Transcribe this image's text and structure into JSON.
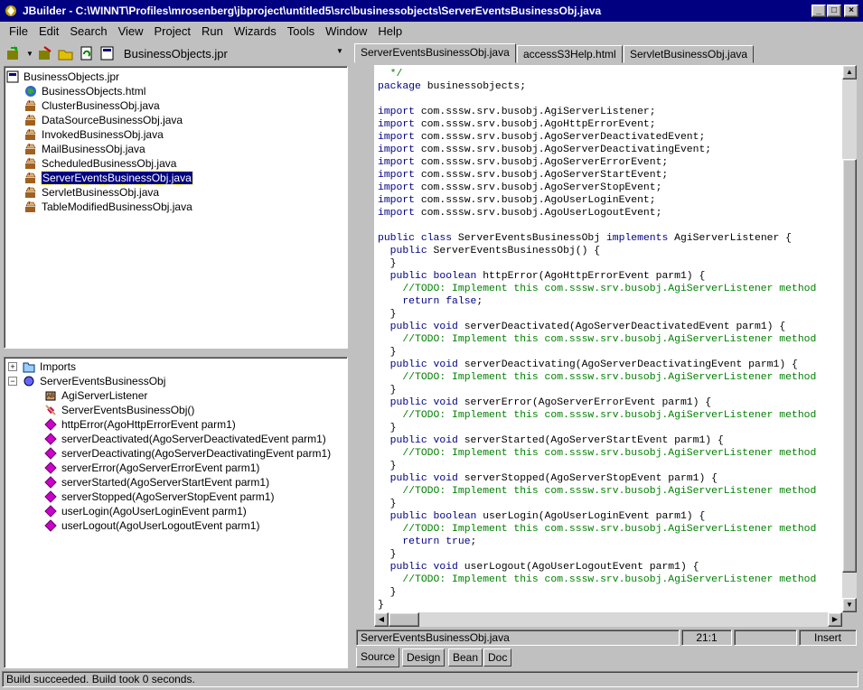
{
  "window": {
    "title": "JBuilder - C:\\WINNT\\Profiles\\mrosenberg\\jbproject\\untitled5\\src\\businessobjects\\ServerEventsBusinessObj.java"
  },
  "menu": [
    "File",
    "Edit",
    "Search",
    "View",
    "Project",
    "Run",
    "Wizards",
    "Tools",
    "Window",
    "Help"
  ],
  "toolbar": {
    "project": "BusinessObjects.jpr"
  },
  "project_tree": {
    "root": "BusinessObjects.jpr",
    "items": [
      "BusinessObjects.html",
      "ClusterBusinessObj.java",
      "DataSourceBusinessObj.java",
      "InvokedBusinessObj.java",
      "MailBusinessObj.java",
      "ScheduledBusinessObj.java",
      "ServerEventsBusinessObj.java",
      "ServletBusinessObj.java",
      "TableModifiedBusinessObj.java"
    ],
    "selected_index": 6
  },
  "structure": {
    "imports": "Imports",
    "class": "ServerEventsBusinessObj",
    "interface": "AgiServerListener",
    "members": [
      "ServerEventsBusinessObj()",
      "httpError(AgoHttpErrorEvent parm1)",
      "serverDeactivated(AgoServerDeactivatedEvent parm1)",
      "serverDeactivating(AgoServerDeactivatingEvent parm1)",
      "serverError(AgoServerErrorEvent parm1)",
      "serverStarted(AgoServerStartEvent parm1)",
      "serverStopped(AgoServerStopEvent parm1)",
      "userLogin(AgoUserLoginEvent parm1)",
      "userLogout(AgoUserLogoutEvent parm1)"
    ]
  },
  "tabs": [
    "ServerEventsBusinessObj.java",
    "accessS3Help.html",
    "ServletBusinessObj.java"
  ],
  "code": [
    [
      "  */",
      "cm"
    ],
    [
      "package businessobjects;",
      "kwfirst"
    ],
    [
      "",
      ""
    ],
    [
      "import com.sssw.srv.busobj.AgiServerListener;",
      "kwfirst"
    ],
    [
      "import com.sssw.srv.busobj.AgoHttpErrorEvent;",
      "kwfirst"
    ],
    [
      "import com.sssw.srv.busobj.AgoServerDeactivatedEvent;",
      "kwfirst"
    ],
    [
      "import com.sssw.srv.busobj.AgoServerDeactivatingEvent;",
      "kwfirst"
    ],
    [
      "import com.sssw.srv.busobj.AgoServerErrorEvent;",
      "kwfirst"
    ],
    [
      "import com.sssw.srv.busobj.AgoServerStartEvent;",
      "kwfirst"
    ],
    [
      "import com.sssw.srv.busobj.AgoServerStopEvent;",
      "kwfirst"
    ],
    [
      "import com.sssw.srv.busobj.AgoUserLoginEvent;",
      "kwfirst"
    ],
    [
      "import com.sssw.srv.busobj.AgoUserLogoutEvent;",
      "kwfirst"
    ],
    [
      "",
      ""
    ],
    [
      "public class ServerEventsBusinessObj implements AgiServerListener {",
      "kw"
    ],
    [
      "  public ServerEventsBusinessObj() {",
      "kw"
    ],
    [
      "  }",
      ""
    ],
    [
      "  public boolean httpError(AgoHttpErrorEvent parm1) {",
      "kw"
    ],
    [
      "    //TODO: Implement this com.sssw.srv.busobj.AgiServerListener method",
      "cm"
    ],
    [
      "    return false;",
      "kw"
    ],
    [
      "  }",
      ""
    ],
    [
      "  public void serverDeactivated(AgoServerDeactivatedEvent parm1) {",
      "kw"
    ],
    [
      "    //TODO: Implement this com.sssw.srv.busobj.AgiServerListener method",
      "cm"
    ],
    [
      "  }",
      ""
    ],
    [
      "  public void serverDeactivating(AgoServerDeactivatingEvent parm1) {",
      "kw"
    ],
    [
      "    //TODO: Implement this com.sssw.srv.busobj.AgiServerListener method",
      "cm"
    ],
    [
      "  }",
      ""
    ],
    [
      "  public void serverError(AgoServerErrorEvent parm1) {",
      "kw"
    ],
    [
      "    //TODO: Implement this com.sssw.srv.busobj.AgiServerListener method",
      "cm"
    ],
    [
      "  }",
      ""
    ],
    [
      "  public void serverStarted(AgoServerStartEvent parm1) {",
      "kw"
    ],
    [
      "    //TODO: Implement this com.sssw.srv.busobj.AgiServerListener method",
      "cm"
    ],
    [
      "  }",
      ""
    ],
    [
      "  public void serverStopped(AgoServerStopEvent parm1) {",
      "kw"
    ],
    [
      "    //TODO: Implement this com.sssw.srv.busobj.AgiServerListener method",
      "cm"
    ],
    [
      "  }",
      ""
    ],
    [
      "  public boolean userLogin(AgoUserLoginEvent parm1) {",
      "kw"
    ],
    [
      "    //TODO: Implement this com.sssw.srv.busobj.AgiServerListener method",
      "cm"
    ],
    [
      "    return true;",
      "kw"
    ],
    [
      "  }",
      ""
    ],
    [
      "  public void userLogout(AgoUserLogoutEvent parm1) {",
      "kw"
    ],
    [
      "    //TODO: Implement this com.sssw.srv.busobj.AgiServerListener method",
      "cm"
    ],
    [
      "  }",
      ""
    ],
    [
      "}",
      ""
    ]
  ],
  "editor_status": {
    "file": "ServerEventsBusinessObj.java",
    "position": "21:1",
    "mode": "Insert"
  },
  "bottom_tabs": [
    "Source",
    "Design",
    "Bean",
    "Doc"
  ],
  "statusbar": "Build succeeded.  Build took 0 seconds."
}
